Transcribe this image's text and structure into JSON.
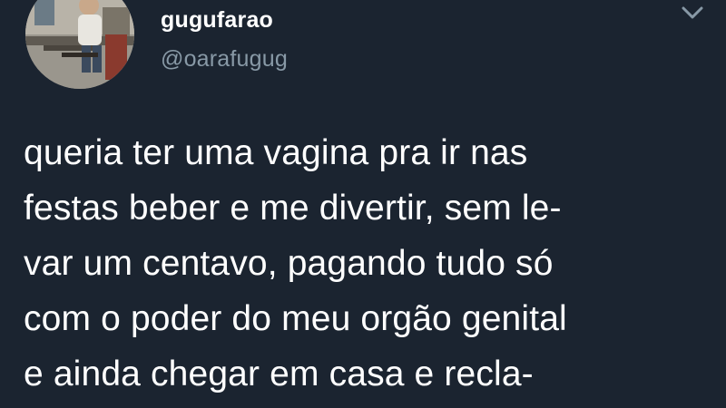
{
  "author": {
    "display_name": "gugufarao",
    "handle": "@oarafugug",
    "avatar_icon": "user-avatar-photo"
  },
  "menu": {
    "icon": "chevron-down-icon"
  },
  "tweet": {
    "lines": [
      "queria ter uma vagina pra ir nas",
      "festas beber e me divertir, sem le-",
      "var um centavo, pagando tudo só",
      "com o poder do meu orgão genital",
      "e ainda chegar em casa e recla-"
    ]
  },
  "colors": {
    "background": "#1b2430",
    "primary_text": "#ffffff",
    "secondary_text": "#8899a6"
  }
}
